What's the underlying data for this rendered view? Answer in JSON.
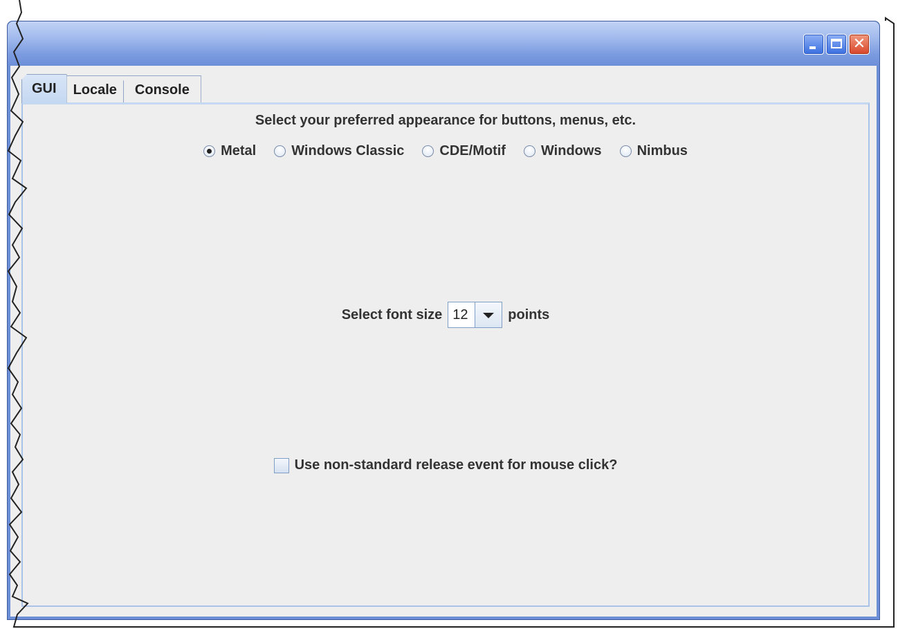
{
  "window": {
    "controls": {
      "minimize_icon": "minimize-icon",
      "maximize_icon": "maximize-icon",
      "close_glyph": "✕"
    }
  },
  "tabs": [
    {
      "label": "GUI",
      "active": true
    },
    {
      "label": "Locale",
      "active": false
    },
    {
      "label": "Console",
      "active": false
    }
  ],
  "gui_panel": {
    "appearance_prompt": "Select your preferred appearance for buttons, menus, etc.",
    "look_and_feel_options": [
      {
        "label": "Metal",
        "selected": true
      },
      {
        "label": "Windows Classic",
        "selected": false
      },
      {
        "label": "CDE/Motif",
        "selected": false
      },
      {
        "label": "Windows",
        "selected": false
      },
      {
        "label": "Nimbus",
        "selected": false
      }
    ],
    "font_size": {
      "prefix": "Select font size",
      "value": "12",
      "suffix": "points"
    },
    "mouse_click_option": {
      "label": "Use non-standard release event for mouse click?",
      "checked": false
    }
  },
  "colors": {
    "window_frame": "#6d8fd8",
    "panel_background": "#eeeeee",
    "tab_active": "#c4d8f1",
    "close_button": "#d9452a"
  }
}
